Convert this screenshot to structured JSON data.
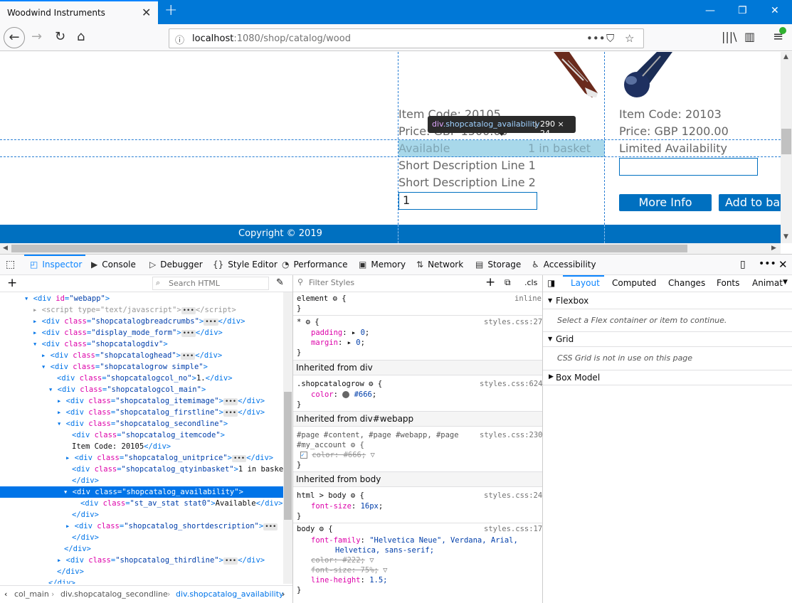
{
  "browser": {
    "tab_title": "Woodwind Instruments",
    "url_host": "localhost",
    "url_path": ":1080/shop/catalog/wood"
  },
  "page": {
    "item1": {
      "code": "Item Code: 20105",
      "price": "Price: GBP 1500.00",
      "availability": "Available",
      "basket": "1 in basket",
      "desc1": "Short Description Line 1",
      "desc2": "Short Description Line 2",
      "qty": "1"
    },
    "item2": {
      "code": "Item Code: 20103",
      "price": "Price: GBP 1200.00",
      "availability": "Limited Availability",
      "more_info": "More Info",
      "add_to_basket": "Add to ba"
    },
    "footer": "Copyright © 2019",
    "tooltip_name": "div.shopcatalog_availability",
    "tooltip_size": "290 × 24"
  },
  "devtools": {
    "tabs": [
      "Inspector",
      "Console",
      "Debugger",
      "Style Editor",
      "Performance",
      "Memory",
      "Network",
      "Storage",
      "Accessibility"
    ],
    "search_placeholder": "Search HTML",
    "filter_placeholder": "Filter Styles",
    "cls_label": ".cls",
    "right_tabs": [
      "Layout",
      "Computed",
      "Changes",
      "Fonts",
      "Animat"
    ],
    "flexbox_title": "Flexbox",
    "flexbox_msg": "Select a Flex container or item to continue.",
    "grid_title": "Grid",
    "grid_msg": "CSS Grid is not in use on this page",
    "boxmodel_title": "Box Model",
    "breadcrumbs": [
      "col_main",
      "div.shopcatalog_secondline",
      "div.shopcatalog_availability"
    ],
    "rules": {
      "element": "element",
      "inline": "inline",
      "star_src": "styles.css:27",
      "inherited_div": "Inherited from div",
      "grow_sel": ".shopcatalogrow",
      "grow_src": "styles.css:624",
      "color_666": "#666",
      "inherited_webapp": "Inherited from div#webapp",
      "webapp_sel1": "#page #content, #page #webapp, #page",
      "webapp_sel2": "#my_account",
      "webapp_src": "styles.css:230",
      "inherited_body": "Inherited from body",
      "htmlbody_sel": "html > body",
      "htmlbody_src": "styles.css:24",
      "font_size_16": "16px",
      "body_sel": "body",
      "body_src": "styles.css:17",
      "font_family_1": "\"Helvetica Neue\", Verdana, Arial,",
      "font_family_2": "Helvetica, sans-serif;",
      "color_222": "#222;",
      "font_size_75": "75%;",
      "line_height": "1.5;"
    }
  },
  "colors": {
    "accent": "#0078d7",
    "page_blue": "#0070c0",
    "highlight": "#a8d8ea"
  }
}
